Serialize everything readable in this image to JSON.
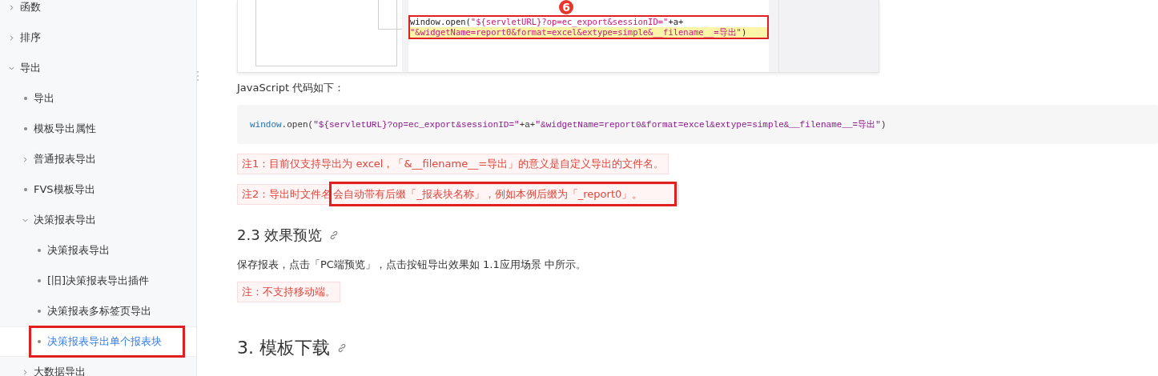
{
  "sidebar": {
    "items": [
      {
        "label": "函数",
        "kind": "folder",
        "expanded": false,
        "selected": false,
        "annotated": false
      },
      {
        "label": "排序",
        "kind": "folder",
        "expanded": false,
        "selected": false,
        "annotated": false
      },
      {
        "label": "导出",
        "kind": "folder",
        "expanded": true,
        "selected": false,
        "annotated": false,
        "children": [
          {
            "label": "导出",
            "selected": false,
            "annotated": false
          },
          {
            "label": "模板导出属性",
            "selected": false,
            "annotated": false
          },
          {
            "label": "普通报表导出",
            "kind": "folder",
            "expanded": false,
            "selected": false,
            "annotated": false
          },
          {
            "label": "FVS模板导出",
            "selected": false,
            "annotated": false
          },
          {
            "label": "决策报表导出",
            "kind": "folder",
            "expanded": true,
            "selected": false,
            "annotated": false,
            "children": [
              {
                "label": "决策报表导出",
                "selected": false,
                "annotated": false
              },
              {
                "label": "[旧]决策报表导出插件",
                "selected": false,
                "annotated": false
              },
              {
                "label": "决策报表多标签页导出",
                "selected": false,
                "annotated": false
              },
              {
                "label": "决策报表导出单个报表块",
                "selected": true,
                "annotated": true
              }
            ]
          },
          {
            "label": "大数据导出",
            "kind": "folder",
            "expanded": false,
            "selected": false,
            "annotated": false
          }
        ]
      }
    ]
  },
  "content": {
    "screenshot": {
      "badge": "6",
      "code_lines": [
        {
          "tokens": [
            {
              "kind": "plain",
              "text": "window.open("
            },
            {
              "kind": "string",
              "text": "\"${servletURL}?op=ec_export&sessionID=\""
            },
            {
              "kind": "plain",
              "text": "+a+"
            }
          ],
          "highlighted": false
        },
        {
          "tokens": [
            {
              "kind": "string",
              "text": "\"&widgetName=report0&format=excel&extype=simple&__filename__=导出\""
            },
            {
              "kind": "plain",
              "text": ")"
            }
          ],
          "highlighted": true
        }
      ]
    },
    "intro": "JavaScript 代码如下：",
    "code": [
      {
        "kind": "object",
        "text": "window"
      },
      {
        "kind": "plain",
        "text": ".open("
      },
      {
        "kind": "string",
        "text": "\"${servletURL}?op=ec_export&sessionID=\""
      },
      {
        "kind": "plain",
        "text": "+a+"
      },
      {
        "kind": "string",
        "text": "\"&widgetName=report0&format=excel&extype=simple&__filename__=导出\""
      },
      {
        "kind": "plain",
        "text": ")"
      }
    ],
    "notes": [
      {
        "text": "注1：目前仅支持导出为 excel，「&__filename__=导出」的意义是自定义导出的文件名。"
      },
      {
        "text": "注2：导出时文件名",
        "marked": "会自动带有后缀「_报表块名称」，例如本例后缀为「_report0」。"
      }
    ],
    "section": {
      "heading": "2.3 效果预览",
      "paragraph": "保存报表，点击「PC端预览」，点击按钮导出效果如 1.1应用场景 中所示。",
      "note": "注：不支持移动端。"
    },
    "next_heading": "3. 模板下载"
  }
}
